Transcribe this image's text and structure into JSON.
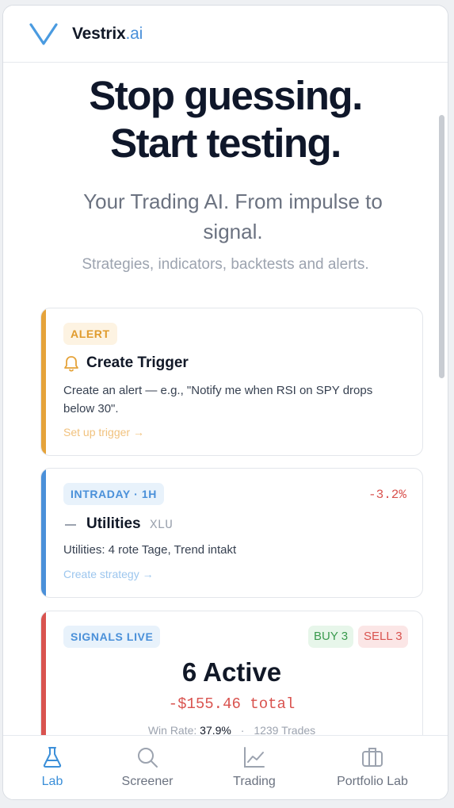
{
  "header": {
    "brand_main": "Vestrix",
    "brand_suffix": ".ai"
  },
  "hero": {
    "title_line1": "Stop guessing.",
    "title_line2": "Start testing.",
    "subtitle": "Your Trading AI. From impulse to signal.",
    "tagline": "Strategies, indicators, backtests and alerts."
  },
  "cards": {
    "alert": {
      "badge": "ALERT",
      "title": "Create Trigger",
      "description": "Create an alert — e.g., \"Notify me when RSI on SPY drops below 30\".",
      "link": "Set up trigger →",
      "icon": "bell-icon",
      "accent": "#e5a33a"
    },
    "intraday": {
      "badge": "INTRADAY · 1H",
      "change": "-3.2%",
      "title": "Utilities",
      "ticker": "XLU",
      "description": "Utilities: 4 rote Tage, Trend intakt",
      "link": "Create strategy →",
      "accent": "#4a90d9"
    },
    "signals": {
      "badge": "SIGNALS LIVE",
      "buy": "BUY 3",
      "sell": "SELL 3",
      "active": "6 Active",
      "total": "-$155.46 total",
      "win_rate_label": "Win Rate:",
      "win_rate": "37.9%",
      "separator": "·",
      "trades": "1239 Trades",
      "accent": "#d9534f"
    }
  },
  "tabs": [
    {
      "label": "Lab",
      "icon": "flask-icon",
      "active": true
    },
    {
      "label": "Screener",
      "icon": "search-icon",
      "active": false
    },
    {
      "label": "Trading",
      "icon": "chart-line-icon",
      "active": false
    },
    {
      "label": "Portfolio Lab",
      "icon": "briefcase-icon",
      "active": false
    }
  ],
  "colors": {
    "accent_blue": "#3b8fd9",
    "negative": "#d9534f",
    "buy_green": "#3a9a4e"
  }
}
